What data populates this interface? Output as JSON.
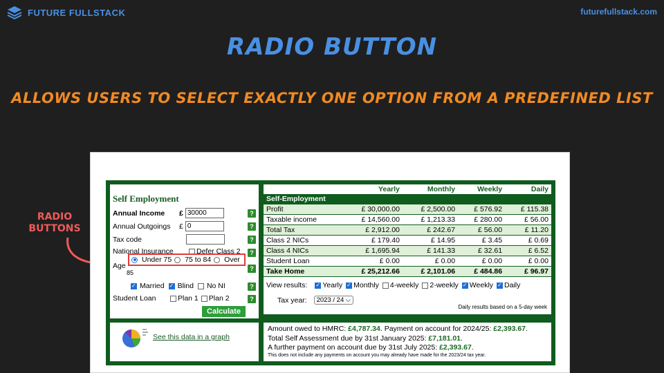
{
  "slide": {
    "brand": "FUTURE FULLSTACK",
    "site": "futurefullstack.com",
    "title": "RADIO BUTTON",
    "subtitle": "ALLOWS USERS TO SELECT EXACTLY ONE OPTION FROM A PREDEFINED LIST",
    "callout_line1": "RADIO",
    "callout_line2": "BUTTONS",
    "colors": {
      "accent_blue": "#4a90e2",
      "accent_orange": "#f08a24",
      "callout_red": "#f05a5a",
      "frame_green": "#0f5c1e"
    }
  },
  "form": {
    "title": "Self Employment",
    "annual_income_label": "Annual Income",
    "currency": "£",
    "annual_income_value": "30000",
    "annual_outgoings_label": "Annual Outgoings",
    "annual_outgoings_value": "0",
    "tax_code_label": "Tax code",
    "tax_code_value": "",
    "ni_label": "National Insurance",
    "defer_label": "Defer Class 2",
    "age_label": "Age",
    "age_label_tail": "85",
    "age_options": [
      "Under 75",
      "75 to 84",
      "Over"
    ],
    "age_selected": 0,
    "married_label": "Married",
    "blind_label": "Blind",
    "no_ni_label": "No NI",
    "student_loan_label": "Student Loan",
    "plan1_label": "Plan 1",
    "plan2_label": "Plan 2",
    "calculate_label": "Calculate",
    "help_glyph": "?"
  },
  "results": {
    "headers": [
      "",
      "Yearly",
      "Monthly",
      "Weekly",
      "Daily"
    ],
    "section_label": "Self-Employment",
    "rows": [
      {
        "label": "Profit",
        "values": [
          "£ 30,000.00",
          "£ 2,500.00",
          "£ 576.92",
          "£ 115.38"
        ]
      },
      {
        "label": "Taxable income",
        "values": [
          "£ 14,560.00",
          "£ 1,213.33",
          "£ 280.00",
          "£ 56.00"
        ]
      },
      {
        "label": "Total Tax",
        "values": [
          "£ 2,912.00",
          "£ 242.67",
          "£ 56.00",
          "£ 11.20"
        ]
      },
      {
        "label": "Class 2 NICs",
        "values": [
          "£ 179.40",
          "£ 14.95",
          "£ 3.45",
          "£ 0.69"
        ]
      },
      {
        "label": "Class 4 NICs",
        "values": [
          "£ 1,695.94",
          "£ 141.33",
          "£ 32.61",
          "£ 6.52"
        ]
      },
      {
        "label": "Student Loan",
        "values": [
          "£ 0.00",
          "£ 0.00",
          "£ 0.00",
          "£ 0.00"
        ]
      },
      {
        "label": "Take Home",
        "values": [
          "£ 25,212.66",
          "£ 2,101.06",
          "£ 484.86",
          "£ 96.97"
        ]
      }
    ]
  },
  "view": {
    "view_results_label": "View results:",
    "options": [
      {
        "label": "Yearly",
        "checked": true
      },
      {
        "label": "Monthly",
        "checked": true
      },
      {
        "label": "4-weekly",
        "checked": false
      },
      {
        "label": "2-weekly",
        "checked": false
      },
      {
        "label": "Weekly",
        "checked": true
      },
      {
        "label": "Daily",
        "checked": true
      }
    ],
    "tax_year_label": "Tax year:",
    "tax_year_value": "2023 / 24",
    "daily_note": "Daily results based on a 5-day week"
  },
  "graph": {
    "link_text": "See this data in a graph"
  },
  "owed": {
    "line1_pre": "Amount owed to HMRC: ",
    "line1_amount": "£4,787.34",
    "line1_mid": ". Payment on account for 2024/25: ",
    "line1_amount2": "£2,393.67",
    "line1_end": ".",
    "line2_pre": "Total Self Assessment due by 31st January 2025: ",
    "line2_amount": "£7,181.01",
    "line2_end": ".",
    "line3_pre": "A further payment on account due by 31st July 2025: ",
    "line3_amount": "£2,393.67",
    "line3_end": ".",
    "note": "This does not include any payments on account you may already have made for the 2023/24 tax year."
  }
}
